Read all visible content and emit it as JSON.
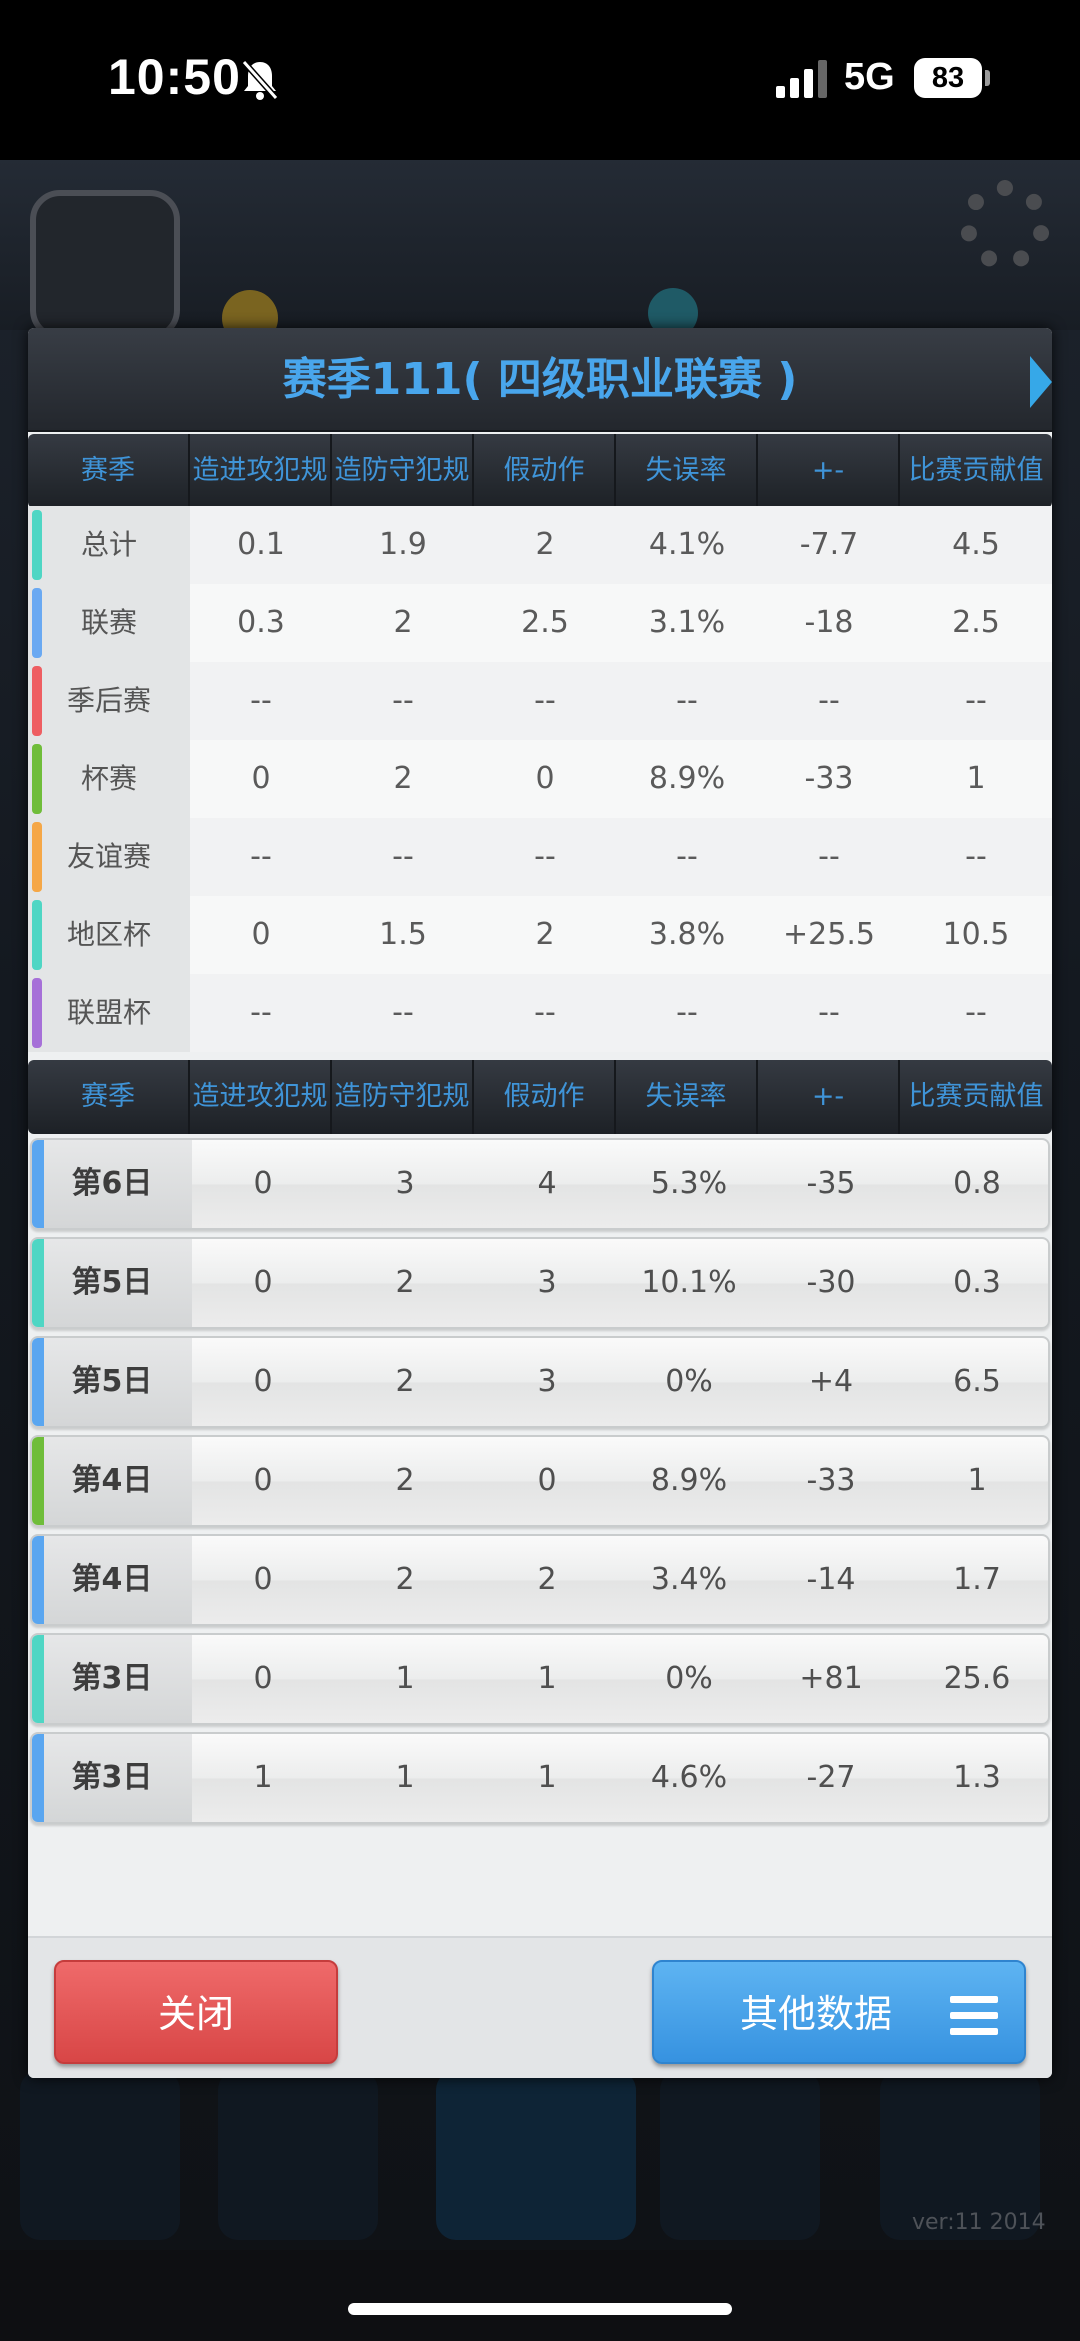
{
  "status_bar": {
    "time": "10:50",
    "network": "5G",
    "battery": "83"
  },
  "background": {
    "version": "ver:11  2014"
  },
  "modal": {
    "title": "赛季111( 四级职业联赛 )",
    "columns": [
      "赛季",
      "造进攻犯规",
      "造防守犯规",
      "假动作",
      "失误率",
      "+-",
      "比赛贡献值"
    ],
    "totals": [
      {
        "label": "总计",
        "color": "#4fd6c4",
        "values": [
          "0.1",
          "1.9",
          "2",
          "4.1%",
          "-7.7",
          "4.5"
        ]
      },
      {
        "label": "联赛",
        "color": "#6aa9f2",
        "values": [
          "0.3",
          "2",
          "2.5",
          "3.1%",
          "-18",
          "2.5"
        ]
      },
      {
        "label": "季后赛",
        "color": "#ee5e62",
        "values": [
          "--",
          "--",
          "--",
          "--",
          "--",
          "--"
        ]
      },
      {
        "label": "杯赛",
        "color": "#6fbd3a",
        "values": [
          "0",
          "2",
          "0",
          "8.9%",
          "-33",
          "1"
        ]
      },
      {
        "label": "友谊赛",
        "color": "#f5a747",
        "values": [
          "--",
          "--",
          "--",
          "--",
          "--",
          "--"
        ]
      },
      {
        "label": "地区杯",
        "color": "#4fd6c4",
        "values": [
          "0",
          "1.5",
          "2",
          "3.8%",
          "+25.5",
          "10.5"
        ]
      },
      {
        "label": "联盟杯",
        "color": "#a670d8",
        "values": [
          "--",
          "--",
          "--",
          "--",
          "--",
          "--"
        ]
      }
    ],
    "games": [
      {
        "label": "第6日",
        "color": "#5aa6f0",
        "values": [
          "0",
          "3",
          "4",
          "5.3%",
          "-35",
          "0.8"
        ]
      },
      {
        "label": "第5日",
        "color": "#4fd6c4",
        "values": [
          "0",
          "2",
          "3",
          "10.1%",
          "-30",
          "0.3"
        ]
      },
      {
        "label": "第5日",
        "color": "#5aa6f0",
        "values": [
          "0",
          "2",
          "3",
          "0%",
          "+4",
          "6.5"
        ]
      },
      {
        "label": "第4日",
        "color": "#6fbd3a",
        "values": [
          "0",
          "2",
          "0",
          "8.9%",
          "-33",
          "1"
        ]
      },
      {
        "label": "第4日",
        "color": "#5aa6f0",
        "values": [
          "0",
          "2",
          "2",
          "3.4%",
          "-14",
          "1.7"
        ]
      },
      {
        "label": "第3日",
        "color": "#4fd6c4",
        "values": [
          "0",
          "1",
          "1",
          "0%",
          "+81",
          "25.6"
        ]
      },
      {
        "label": "第3日",
        "color": "#5aa6f0",
        "values": [
          "1",
          "1",
          "1",
          "4.6%",
          "-27",
          "1.3"
        ]
      }
    ],
    "close_label": "关闭",
    "other_data_label": "其他数据"
  }
}
